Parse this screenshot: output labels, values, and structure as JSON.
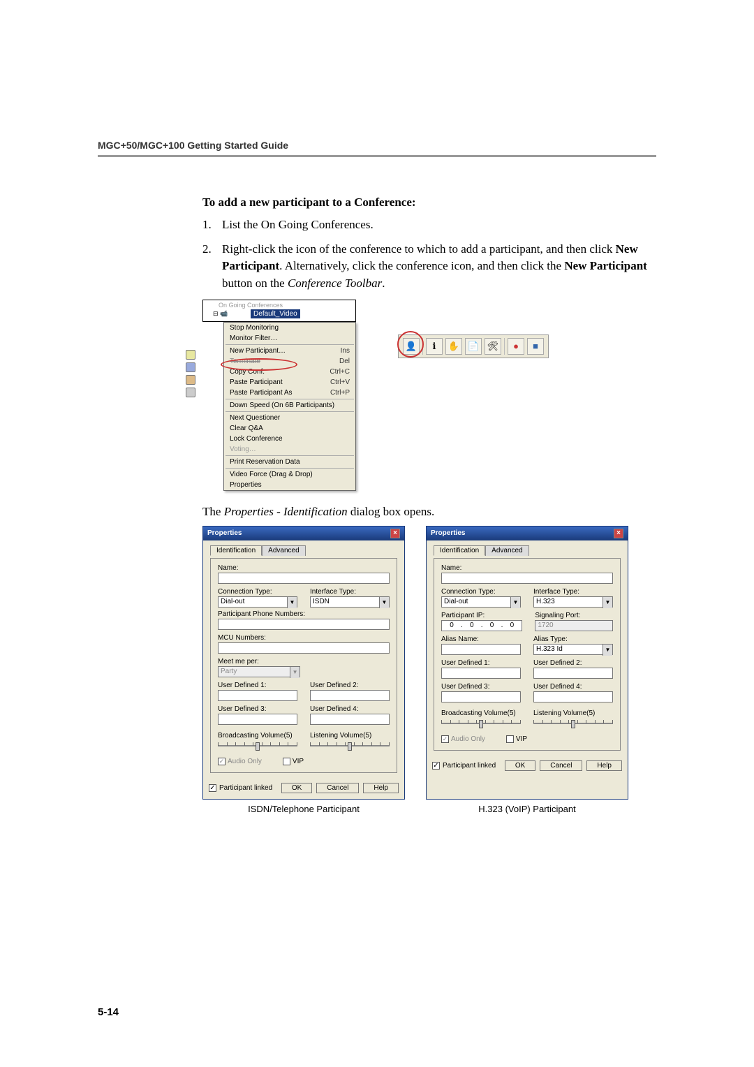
{
  "runningHead": "MGC+50/MGC+100 Getting Started Guide",
  "pageNumber": "5-14",
  "sectionTitle": "To add a new participant to a Conference:",
  "steps": [
    {
      "n": "1.",
      "plain": "List the On Going Conferences."
    },
    {
      "n": "2.",
      "p1": "Right-click the icon of the conference to which to add a participant, and then click ",
      "b1": "New Participant",
      "p2": ". Alternatively, click the conference icon, and then click the ",
      "b2": "New Participant",
      "p3": " button on the ",
      "i1": "Conference Toolbar",
      "p4": "."
    }
  ],
  "tree": {
    "topLine": "On Going Conferences",
    "selected": "Default_Video"
  },
  "contextMenu": [
    {
      "label": "Stop Monitoring"
    },
    {
      "label": "Monitor Filter…"
    },
    {
      "sep": true
    },
    {
      "label": "New Participant…",
      "hotkey": "Ins",
      "highlight": true
    },
    {
      "label": "Terminate",
      "hotkey": "Del",
      "strike": true
    },
    {
      "label": "Copy Conf.",
      "hotkey": "Ctrl+C"
    },
    {
      "label": "Paste Participant",
      "hotkey": "Ctrl+V"
    },
    {
      "label": "Paste Participant As",
      "hotkey": "Ctrl+P"
    },
    {
      "sep": true
    },
    {
      "label": "Down Speed (On 6B Participants)"
    },
    {
      "sep": true
    },
    {
      "label": "Next Questioner"
    },
    {
      "label": "Clear Q&A"
    },
    {
      "label": "Lock Conference"
    },
    {
      "label": "Voting…",
      "disabled": true
    },
    {
      "sep": true
    },
    {
      "label": "Print Reservation Data"
    },
    {
      "sep": true
    },
    {
      "label": "Video Force (Drag & Drop)"
    },
    {
      "label": "Properties"
    }
  ],
  "toolbarIcons": [
    "new-participant-icon",
    "info-icon",
    "hand-icon",
    "document-icon",
    "tools-icon",
    "record-icon",
    "stop-icon"
  ],
  "opensLine_p1": "The ",
  "opensLine_i": "Properties - Identification",
  "opensLine_p2": " dialog box opens.",
  "dialog": {
    "title": "Properties",
    "tabs": {
      "active": "Identification",
      "inactive": "Advanced"
    },
    "labels": {
      "name": "Name:",
      "connType": "Connection Type:",
      "ifType": "Interface Type:",
      "partPhone": "Participant Phone Numbers:",
      "mcuNum": "MCU Numbers:",
      "meetMe": "Meet me per:",
      "partIP": "Participant IP:",
      "sigPort": "Signaling Port:",
      "aliasName": "Alias Name:",
      "aliasType": "Alias Type:",
      "ud1": "User Defined 1:",
      "ud2": "User Defined 2:",
      "ud3": "User Defined 3:",
      "ud4": "User Defined 4:",
      "broadcast": "Broadcasting Volume(5)",
      "listen": "Listening Volume(5)",
      "audioOnly": "Audio Only",
      "vip": "VIP",
      "linked": "Participant linked"
    },
    "values": {
      "connType": "Dial-out",
      "ifISDN": "ISDN",
      "ifH323": "H.323",
      "meetMe": "Party",
      "ip": [
        "0",
        "0",
        "0",
        "0"
      ],
      "sigPort": "1720",
      "aliasType": "H.323 Id"
    },
    "buttons": {
      "ok": "OK",
      "cancel": "Cancel",
      "help": "Help"
    }
  },
  "captions": {
    "left": "ISDN/Telephone Participant",
    "right": "H.323 (VoIP) Participant"
  }
}
